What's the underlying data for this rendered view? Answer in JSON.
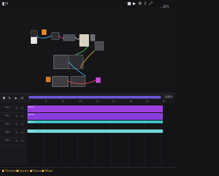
{
  "topbar": {
    "zoom_label": "75%"
  },
  "timeline": {
    "zoom_label": "100%",
    "ruler_marks": [
      "1",
      "5",
      "9",
      "13",
      "17",
      "21",
      "25",
      "29",
      "33"
    ],
    "tracks": [
      {
        "label": "Pt 1"
      },
      {
        "label": "Pt 2"
      },
      {
        "label": "Pt 3"
      },
      {
        "label": "Rec"
      },
      {
        "label": "Pt 5"
      }
    ],
    "clips": [
      {
        "label": "Pattern",
        "color": "#9b3fe0"
      },
      {
        "label": "Pattern",
        "color": "#8a3ddd"
      },
      {
        "label": "Pattern",
        "color": "#3fc3c9"
      },
      {
        "label": "Pattern",
        "color": "#6fd3d6"
      }
    ]
  },
  "bottom_tabs": [
    {
      "label": "Timeline"
    },
    {
      "label": "Studio"
    },
    {
      "label": "Piano"
    },
    {
      "label": "Mixer"
    }
  ],
  "colors": {
    "accent_purple": "#9b3fe0",
    "accent_cyan": "#3fc3c9",
    "tab_gold": "#e0b340"
  }
}
